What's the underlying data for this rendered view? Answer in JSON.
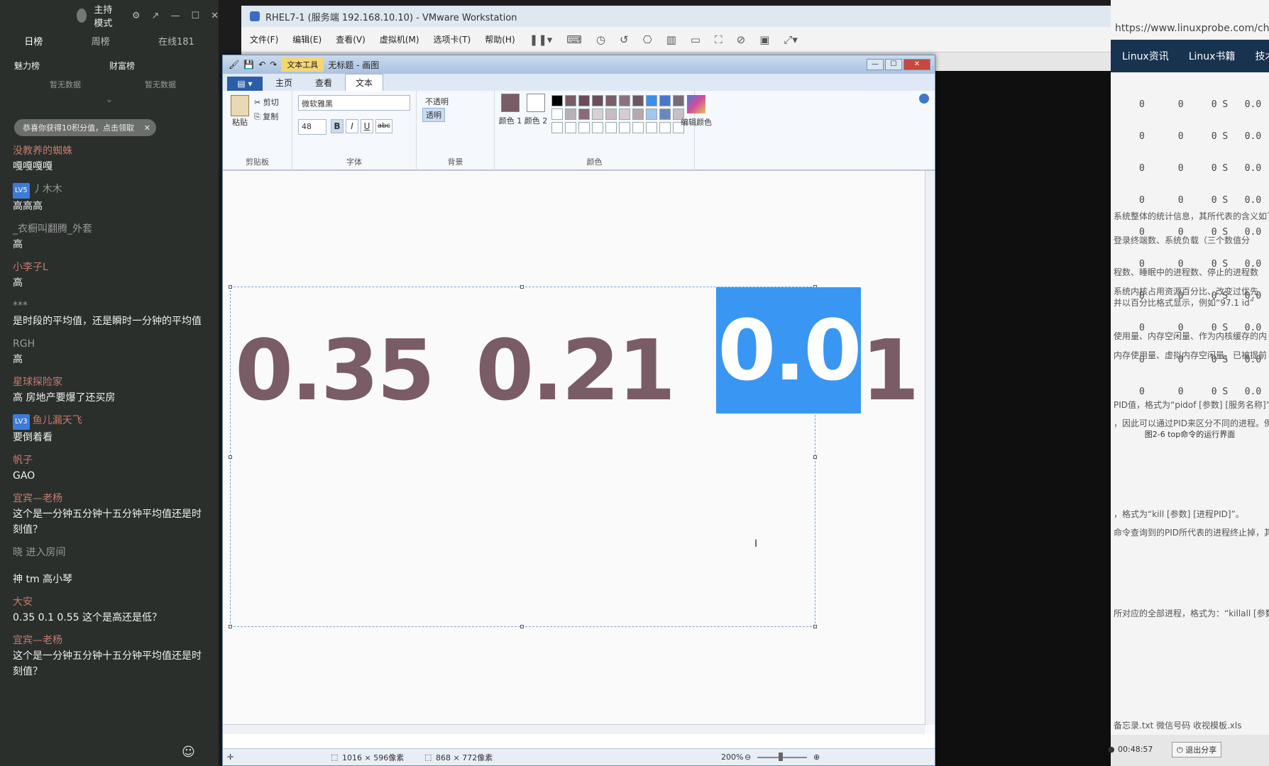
{
  "chat": {
    "host_mode": "主持模式",
    "tabs": [
      "日榜",
      "周榜",
      "在线181"
    ],
    "rank_charm": "魅力榜",
    "rank_wealth": "财富榜",
    "rank_empty": "暂无数据",
    "notice": "恭喜你获得10积分值，点击领取",
    "messages": [
      {
        "user": "没教养的蜘蛛",
        "text": "嘎嘎嘎嘎",
        "badge": ""
      },
      {
        "user": "丿木木",
        "text": "高高高",
        "badge": "LV5"
      },
      {
        "user": "_衣橱叫翻腾_外套",
        "text": "高",
        "badge": ""
      },
      {
        "user": "小李子L",
        "text": "高",
        "badge": ""
      },
      {
        "user": "***",
        "text": "是时段的平均值，还是瞬时一分钟的平均值",
        "badge": ""
      },
      {
        "user": "RGH",
        "text": "高",
        "badge": ""
      },
      {
        "user": "星球探险家",
        "text": "高 房地产要爆了还买房",
        "badge": ""
      },
      {
        "user": "鱼儿漏天飞",
        "text": "要倒着看",
        "badge": "LV3"
      },
      {
        "user": "帆子",
        "text": "GAO",
        "badge": ""
      },
      {
        "user": "宜宾—老杨",
        "text": "这个是一分钟五分钟十五分钟平均值还是时刻值？",
        "badge": ""
      },
      {
        "user": "晓 进入房间",
        "text": "",
        "badge": ""
      },
      {
        "user": "",
        "text": "神 tm  高小琴",
        "badge": ""
      },
      {
        "user": "大安",
        "text": "0.35  0.1  0.55  这个是高还是低？",
        "badge": ""
      },
      {
        "user": "宜宾—老杨",
        "text": "这个是一分钟五分钟十五分钟平均值还是时刻值？",
        "badge": ""
      }
    ]
  },
  "vmware": {
    "title": "RHEL7-1 (服务端 192.168.10.10) - VMware Workstation",
    "menu": [
      "文件(F)",
      "编辑(E)",
      "查看(V)",
      "虚拟机(M)",
      "选项卡(T)",
      "帮助(H)"
    ]
  },
  "paint": {
    "title_context": "文本工具",
    "title": "无标题 - 画图",
    "tabs": {
      "file": "▤ ▾",
      "home": "主页",
      "view": "查看",
      "text": "文本"
    },
    "clipboard": {
      "paste": "粘贴",
      "cut": "剪切",
      "copy": "复制",
      "label": "剪贴板"
    },
    "font": {
      "name": "微软雅黑",
      "size": "48",
      "bold": "B",
      "italic": "I",
      "underline": "U",
      "strike": "abc",
      "label": "字体"
    },
    "background": {
      "opaque": "不透明",
      "transparent": "透明",
      "label": "背景"
    },
    "colors": {
      "color1": "颜色 1",
      "color2": "颜色 2",
      "edit": "编辑颜色",
      "label": "颜色"
    },
    "canvas_text": {
      "a": "0.35",
      "b": "0.21",
      "c_sel": "0.0",
      "c_tail": "1"
    },
    "status": {
      "selection_size": "1016 × 596像素",
      "canvas_size": "868 × 772像素",
      "zoom": "200%"
    }
  },
  "browser": {
    "url": "https://www.linuxprobe.com/chap",
    "nav": [
      "Linux资讯",
      "Linux书籍",
      "技术"
    ],
    "proc_rows": [
      "0      0     0 S   0.0",
      "0      0     0 S   0.0",
      "0      0     0 S   0.0",
      "0      0     0 S   0.0",
      "0      0     0 S   0.0",
      "0      0     0 S   0.0",
      "0      0     0 S   0.0",
      "0      0     0 S   0.0",
      "0      0     0 S   0.0",
      "0      0     0 S   0.0"
    ],
    "caption": "图2-6  top命令的运行界面",
    "lines": [
      "系统整体的统计信息，其所代表的含义如下。",
      "登录终端数、系统负载（三个数值分",
      "程数、睡眠中的进程数、停止的进程数",
      "系统内核占用资源百分比、改变过优先",
      "并以百分比格式显示，例如“97.1 id”",
      "使用量、内存空闲量、作为内核缓存的内",
      "内存使用量、虚拟内存空闲量、已被提前",
      "PID值，格式为“pidof [参数] [服务名称]”。",
      "，因此可以通过PID来区分不同的进程。例如",
      "，格式为“kill [参数] [进程PID]”。",
      "命令查询到的PID所代表的进程终止掉，其命",
      "所对应的全部进程，格式为：“killall [参数] [",
      "备忘录.txt    微信号码    收视模板.xls"
    ]
  },
  "taskbar": {
    "timer": "00:48:57",
    "exit_share": "退出分享"
  }
}
